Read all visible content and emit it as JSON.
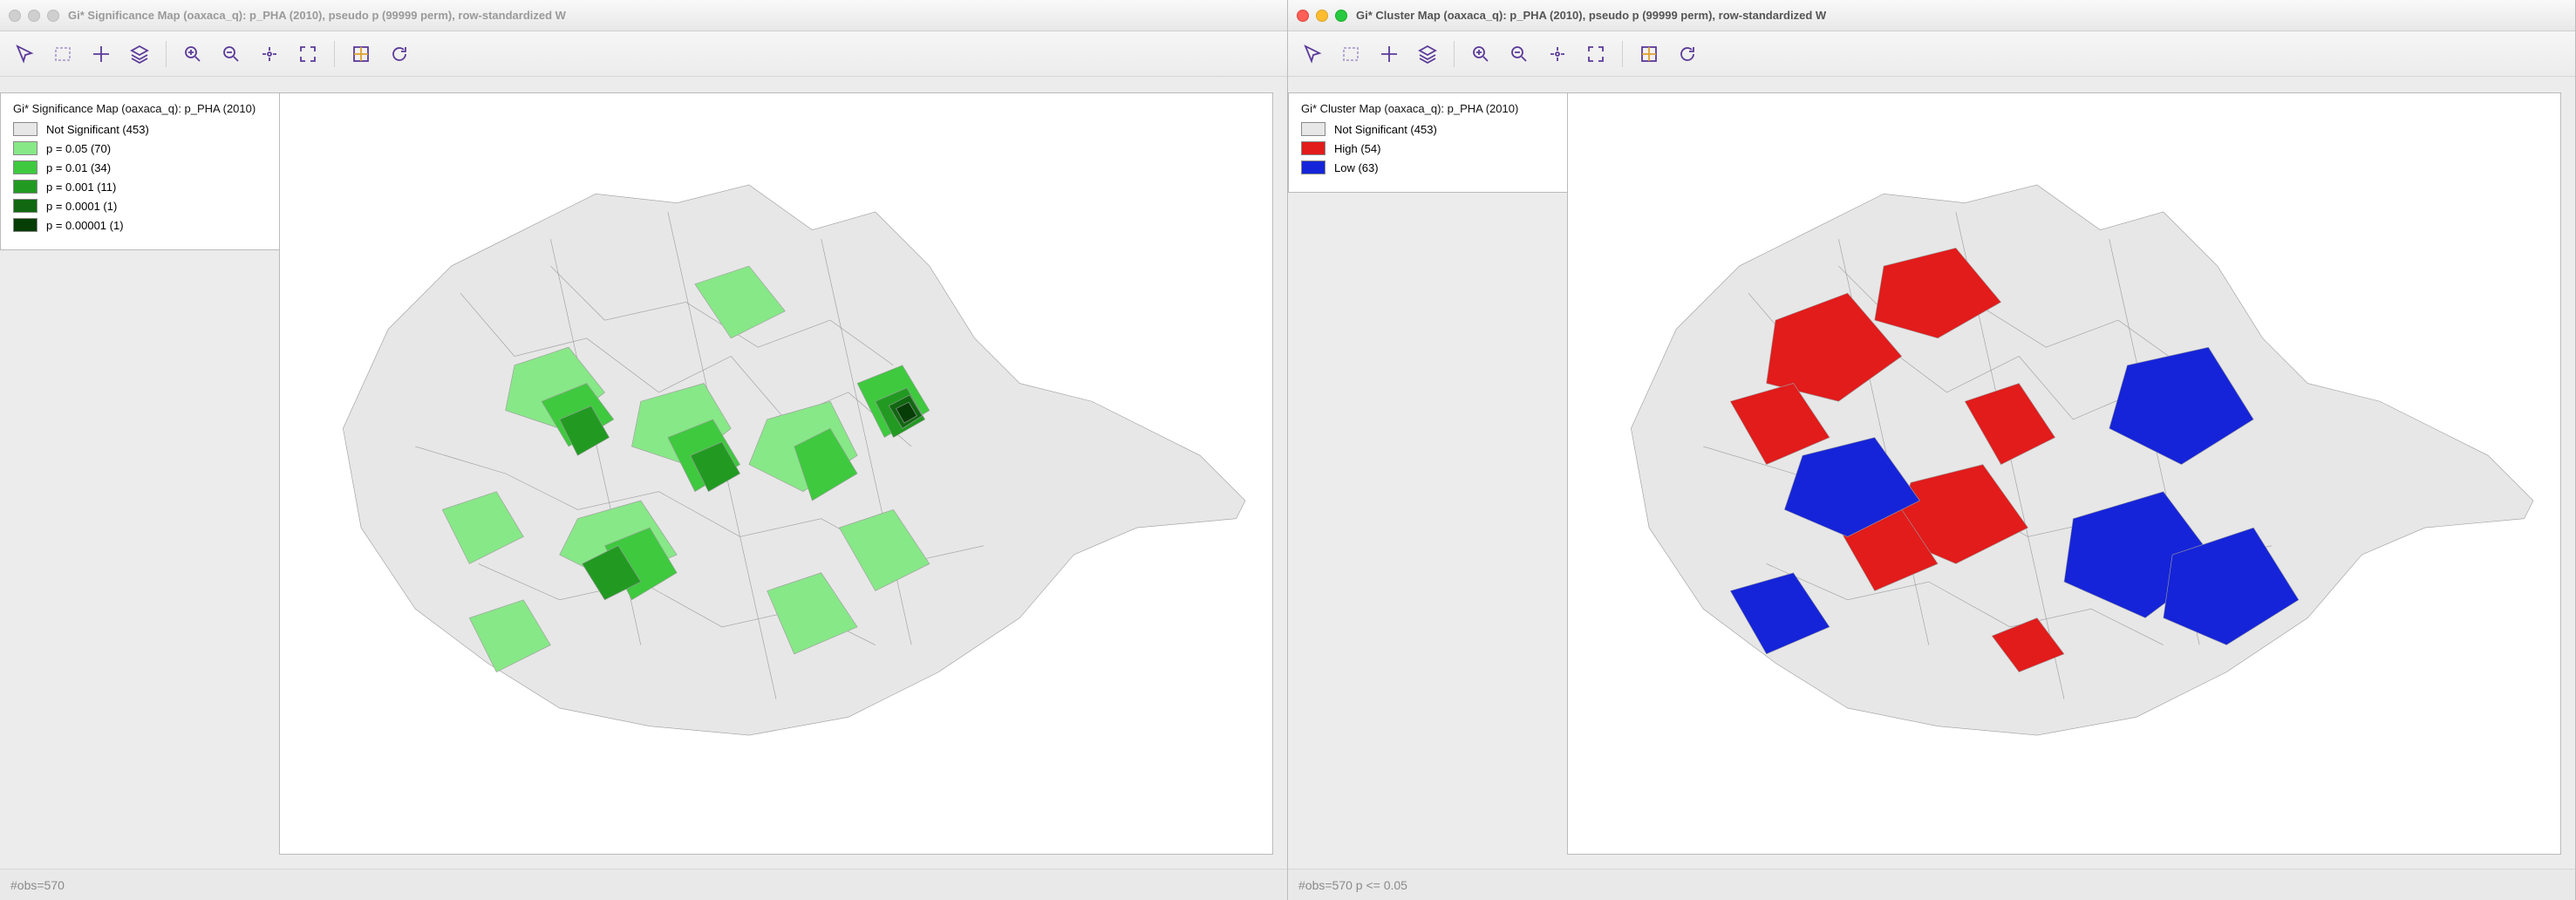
{
  "left": {
    "title": "Gi* Significance Map (oaxaca_q): p_PHA (2010), pseudo p (99999 perm), row-standardized W",
    "legend_title": "Gi* Significance Map (oaxaca_q): p_PHA (2010)",
    "status": "#obs=570",
    "legend": [
      {
        "label": "Not Significant (453)",
        "swatch": "#e7e7e7"
      },
      {
        "label": "p = 0.05 (70)",
        "swatch": "#87e887"
      },
      {
        "label": "p = 0.01 (34)",
        "swatch": "#3fc93f"
      },
      {
        "label": "p = 0.001 (11)",
        "swatch": "#229a22"
      },
      {
        "label": "p = 0.0001 (1)",
        "swatch": "#116811"
      },
      {
        "label": "p = 0.00001 (1)",
        "swatch": "#073d07"
      }
    ]
  },
  "right": {
    "title": "Gi* Cluster Map (oaxaca_q): p_PHA (2010), pseudo p (99999 perm), row-standardized W",
    "legend_title": "Gi* Cluster Map (oaxaca_q): p_PHA (2010)",
    "status": "#obs=570  p <= 0.05",
    "legend": [
      {
        "label": "Not Significant (453)",
        "swatch": "#e7e7e7"
      },
      {
        "label": "High (54)",
        "swatch": "#e21b1b"
      },
      {
        "label": "Low (63)",
        "swatch": "#1524d8"
      }
    ]
  },
  "toolbar": {
    "pointer": "Pointer",
    "select_rect": "Rectangle Select",
    "pan": "Pan",
    "layers": "Layers",
    "zoom_in": "Zoom In",
    "zoom_out": "Zoom Out",
    "fit": "Fit To Window",
    "full_extent": "Full Extent",
    "basemap": "Basemap",
    "refresh": "Refresh"
  },
  "chart_data": [
    {
      "type": "map",
      "title": "Gi* Significance Map (oaxaca_q): p_PHA (2010)",
      "categories": [
        "Not Significant",
        "p = 0.05",
        "p = 0.01",
        "p = 0.001",
        "p = 0.0001",
        "p = 0.00001"
      ],
      "values": [
        453,
        70,
        34,
        11,
        1,
        1
      ],
      "colors": [
        "#e7e7e7",
        "#87e887",
        "#3fc93f",
        "#229a22",
        "#116811",
        "#073d07"
      ],
      "n_obs": 570
    },
    {
      "type": "map",
      "title": "Gi* Cluster Map (oaxaca_q): p_PHA (2010)",
      "categories": [
        "Not Significant",
        "High",
        "Low"
      ],
      "values": [
        453,
        54,
        63
      ],
      "colors": [
        "#e7e7e7",
        "#e21b1b",
        "#1524d8"
      ],
      "n_obs": 570,
      "p_threshold": 0.05
    }
  ]
}
